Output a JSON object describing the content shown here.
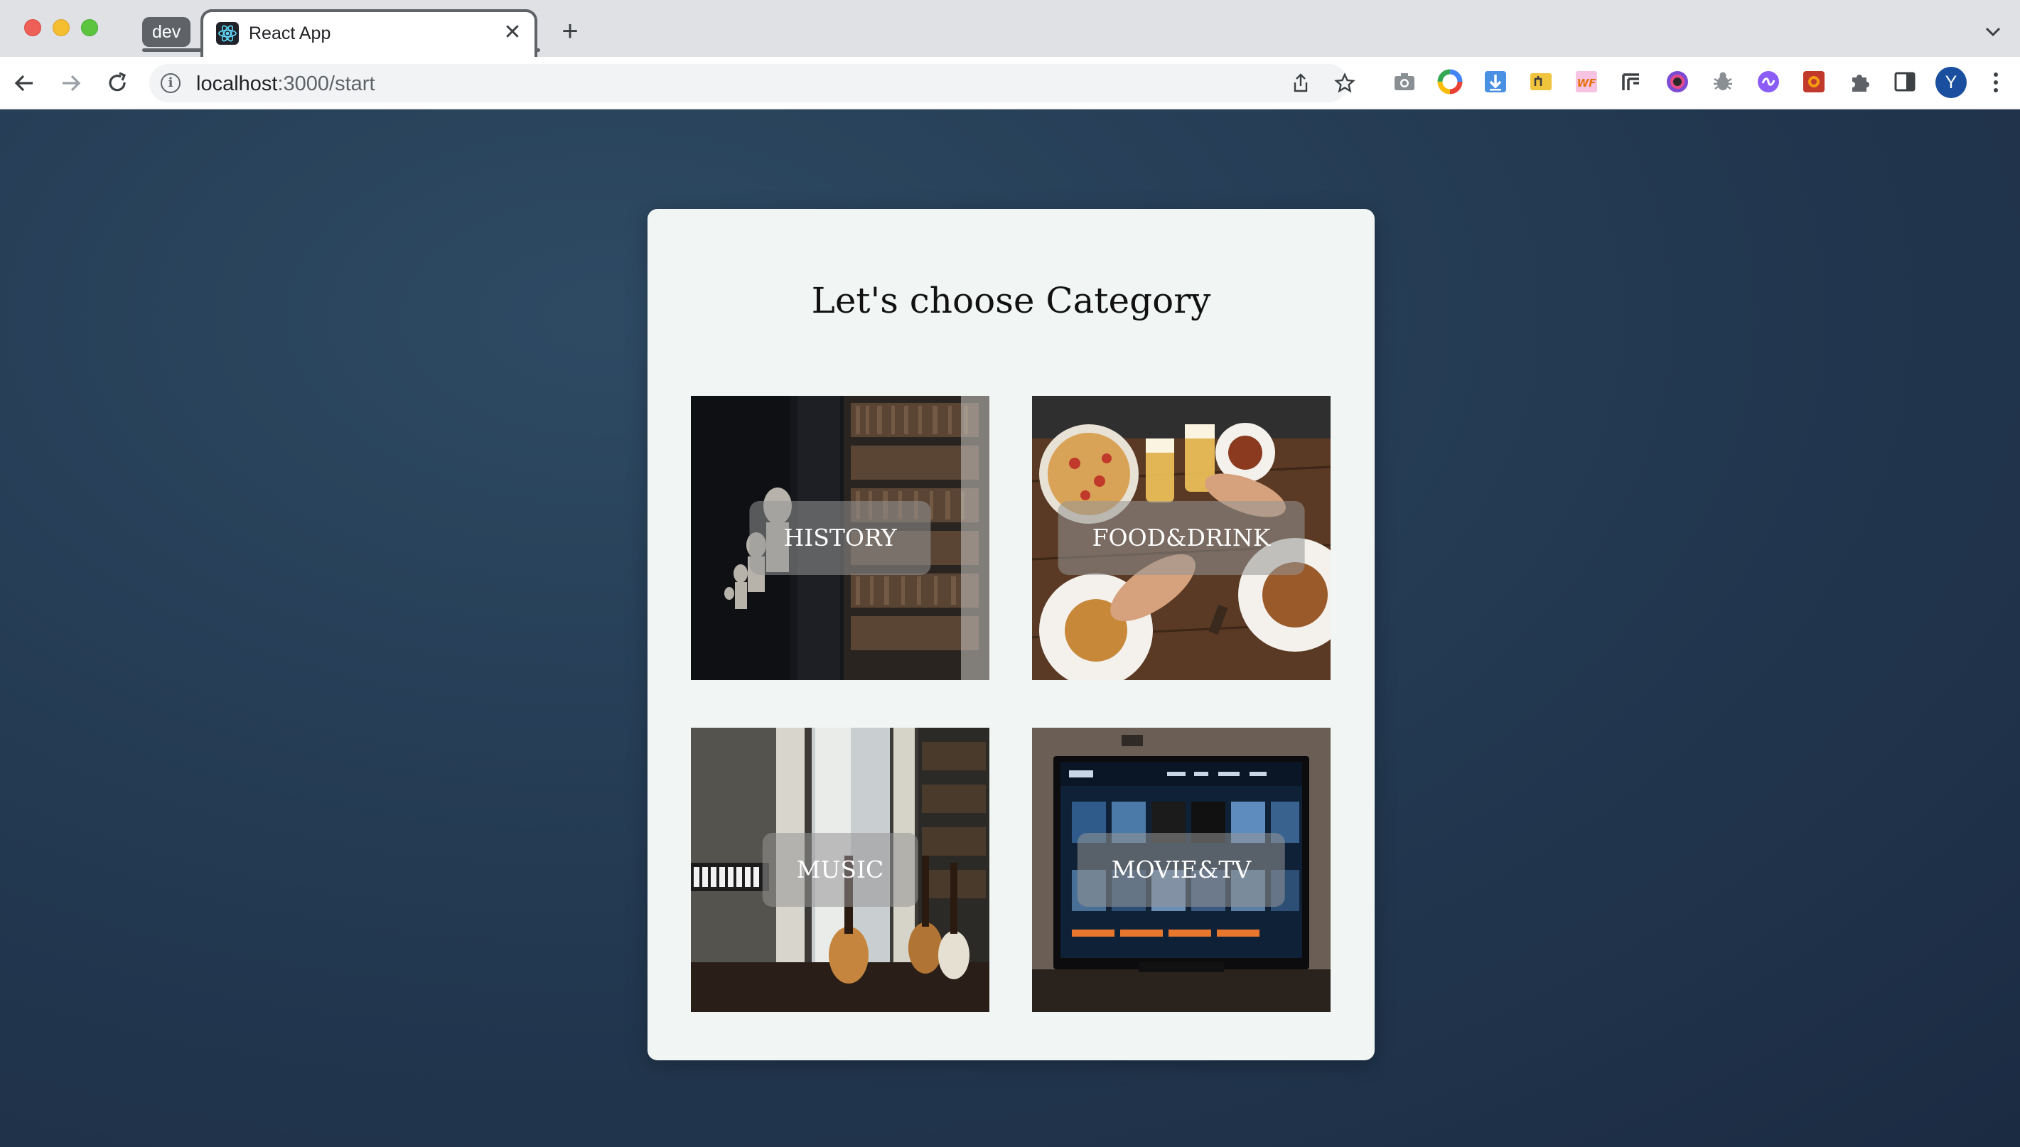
{
  "browser": {
    "tab_group_label": "dev",
    "tab_title": "React App",
    "new_tab_symbol": "+",
    "close_symbol": "✕",
    "url_host": "localhost",
    "url_path": ":3000/start",
    "profile_initial": "Y"
  },
  "page": {
    "title": "Let's choose Category",
    "categories": [
      {
        "label": "HISTORY",
        "image": "library-bookshelves-with-busts"
      },
      {
        "label": "FOOD&DRINK",
        "image": "table-of-food-and-beer-cheers"
      },
      {
        "label": "MUSIC",
        "image": "room-with-guitars-and-keyboard"
      },
      {
        "label": "MOVIE&TV",
        "image": "tv-showing-streaming-app"
      }
    ]
  },
  "colors": {
    "page_background": "#243b53",
    "card_background": "#f1f5f4",
    "label_overlay": "rgba(150,150,150,0.55)",
    "profile_avatar": "#1a4fa0"
  }
}
